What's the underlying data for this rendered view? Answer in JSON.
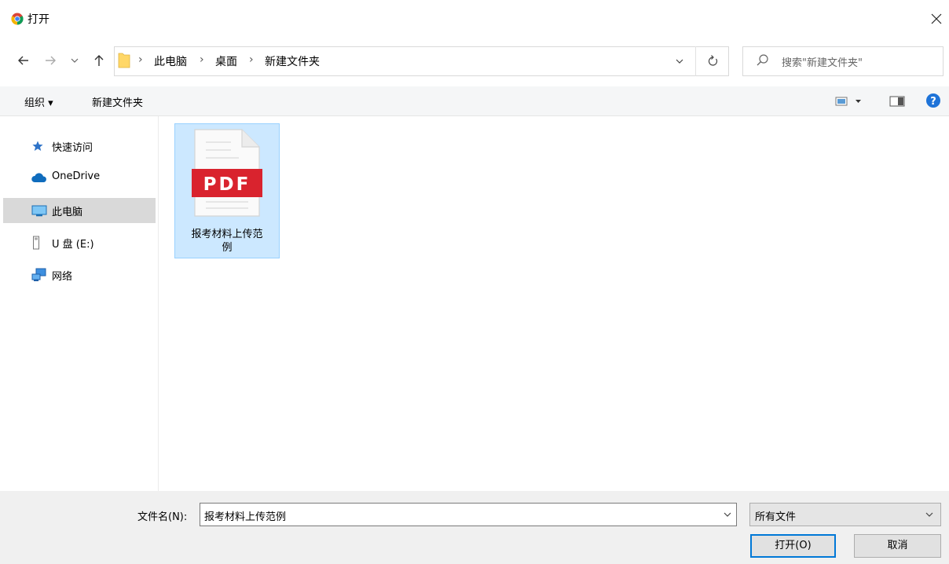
{
  "window": {
    "title": "打开"
  },
  "breadcrumb": {
    "items": [
      "此电脑",
      "桌面",
      "新建文件夹"
    ]
  },
  "search": {
    "placeholder": "搜索\"新建文件夹\""
  },
  "toolbar": {
    "organize_label": "组织 ▾",
    "new_folder_label": "新建文件夹"
  },
  "nav": {
    "items": [
      {
        "label": "快速访问",
        "icon": "star-icon"
      },
      {
        "label": "OneDrive",
        "icon": "cloud-icon"
      },
      {
        "label": "此电脑",
        "icon": "monitor-icon",
        "selected": true
      },
      {
        "label": "U 盘 (E:)",
        "icon": "usb-drive-icon"
      },
      {
        "label": "网络",
        "icon": "network-icon"
      }
    ]
  },
  "files": [
    {
      "name": "报考材料上传范例",
      "name_line1": "报考材料上传范",
      "name_line2": "例",
      "badge": "PDF",
      "selected": true
    }
  ],
  "bottom": {
    "filename_label": "文件名(N):",
    "filename_value": "报考材料上传范例",
    "filter_value": "所有文件",
    "open_label": "打开(O)",
    "cancel_label": "取消"
  },
  "colors": {
    "accent": "#0078d7",
    "selection": "#cce8ff",
    "pdf_red": "#d9232e",
    "folder_yellow": "#ffd767",
    "help_blue": "#1e73d8"
  }
}
